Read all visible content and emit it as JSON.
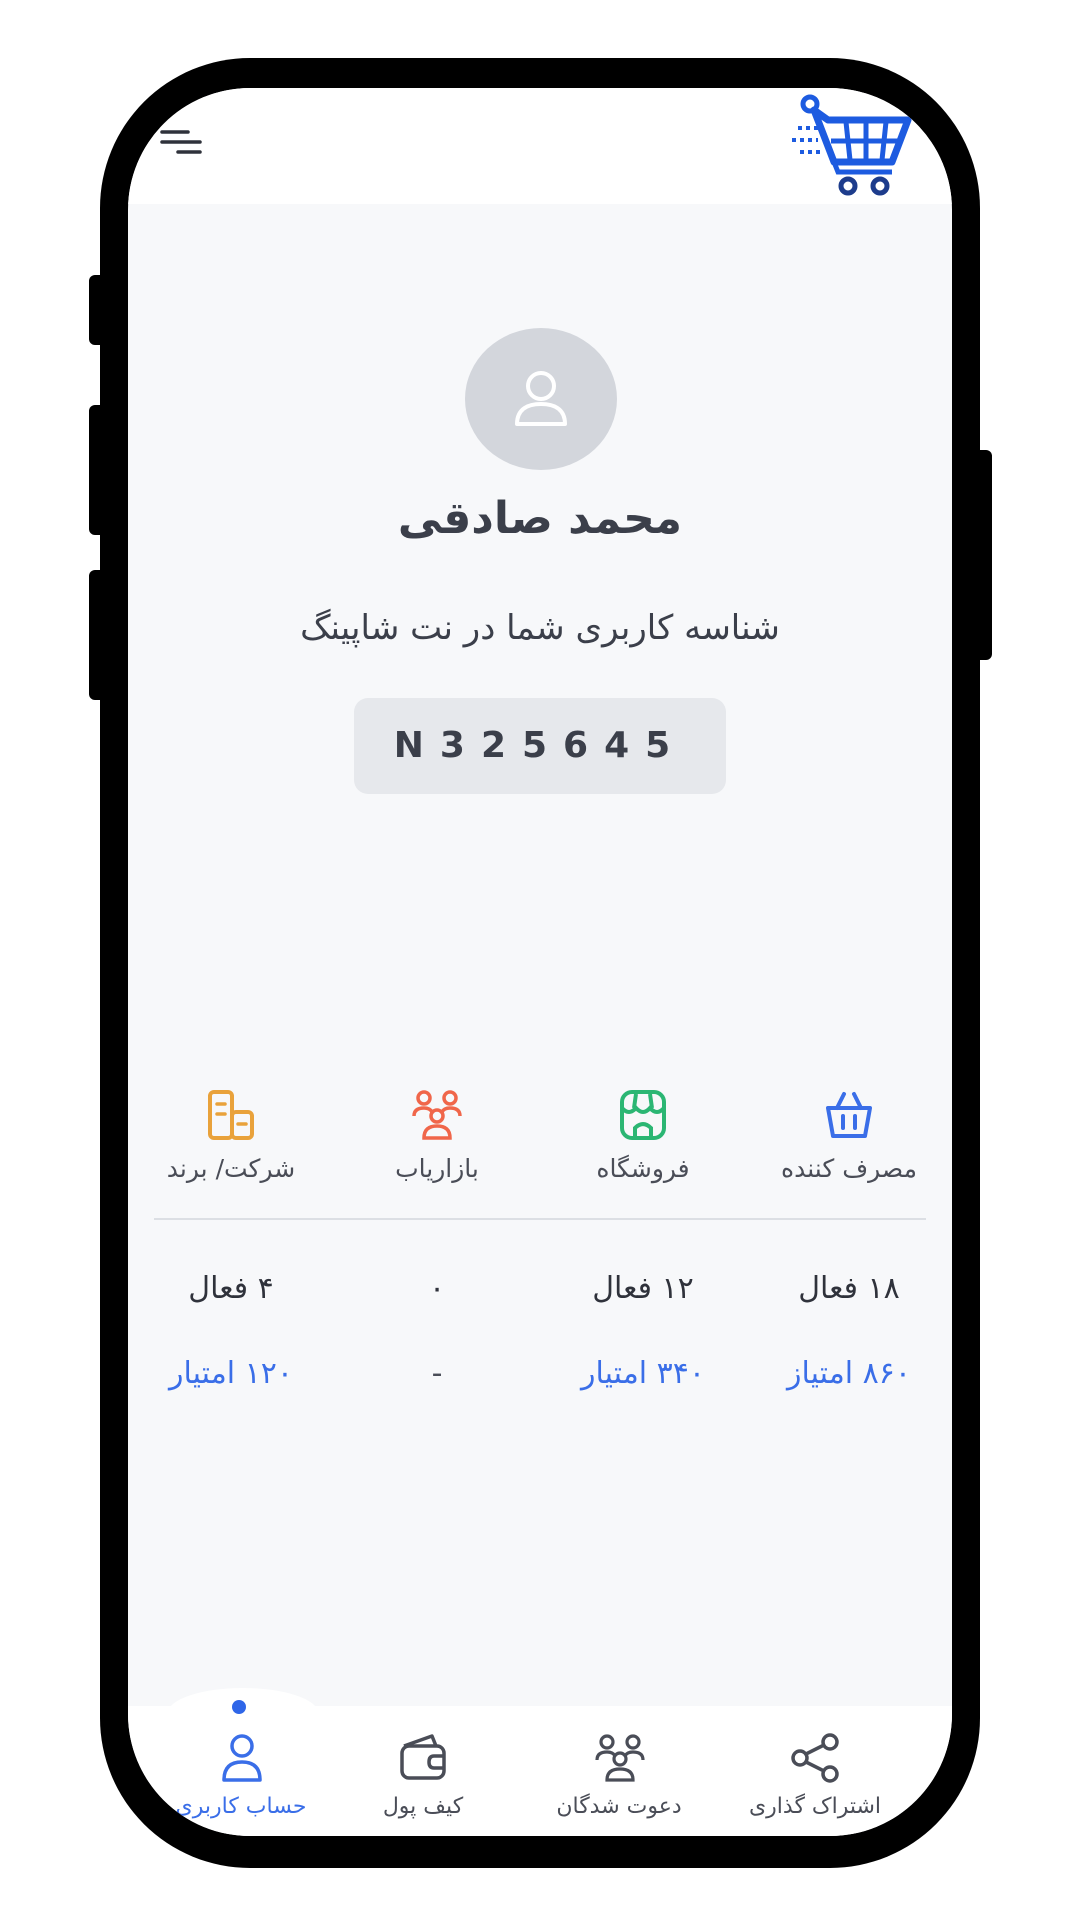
{
  "header": {
    "menu_icon": "menu-icon",
    "logo_icon": "shopping-cart-logo"
  },
  "profile": {
    "avatar_icon": "user-avatar-icon",
    "name": "محمد صادقی",
    "id_label": "شناسه کاربری شما در نت شاپینگ",
    "user_id": "N325645"
  },
  "stats": [
    {
      "icon": "basket-icon",
      "label": "مصرف کننده",
      "active": "۱۸ فعال",
      "points": "۸۶۰ امتیاز",
      "color": "#3a6ee8"
    },
    {
      "icon": "store-icon",
      "label": "فروشگاه",
      "active": "۱۲ فعال",
      "points": "۳۴۰ امتیار",
      "color": "#2bb673"
    },
    {
      "icon": "people-group-icon",
      "label": "بازاریاب",
      "active": "۰",
      "points": "-",
      "color": "#f0664a"
    },
    {
      "icon": "building-icon",
      "label": "شرکت/ برند",
      "active": "۴ فعال",
      "points": "۱۲۰ امتیار",
      "color": "#e9a23b"
    }
  ],
  "bottom_nav": [
    {
      "icon": "share-icon",
      "label": "اشتراک گذاری",
      "active": false
    },
    {
      "icon": "people-group-icon",
      "label": "دعوت شدگان",
      "active": false
    },
    {
      "icon": "wallet-icon",
      "label": "کیف پول",
      "active": false
    },
    {
      "icon": "user-icon",
      "label": "حساب کاربری",
      "active": true
    }
  ],
  "colors": {
    "accent": "#3a6ee8",
    "background": "#f7f8fa",
    "text": "#3b3f4a"
  }
}
